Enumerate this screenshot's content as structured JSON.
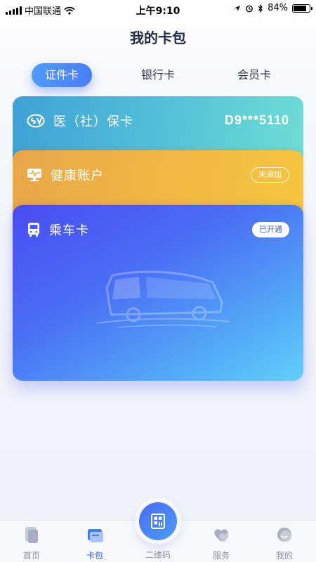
{
  "status_bar": {
    "carrier": "中国联通",
    "time": "上午9:10",
    "battery": "84%",
    "battery_level": 0.84
  },
  "header": {
    "title": "我的卡包"
  },
  "tabs": [
    {
      "label": "证件卡",
      "active": true
    },
    {
      "label": "银行卡",
      "active": false
    },
    {
      "label": "会员卡",
      "active": false
    }
  ],
  "cards": {
    "social_security": {
      "title": "医（社）保卡",
      "number": "D9***5110",
      "icon": "social-security-logo-icon"
    },
    "health": {
      "title": "健康账户",
      "badge": "未添加",
      "icon": "health-monitor-icon"
    },
    "bus": {
      "title": "乘车卡",
      "badge": "已开通",
      "icon": "bus-icon"
    }
  },
  "bottom_nav": {
    "items": [
      {
        "label": "首页",
        "icon": "home-icon",
        "active": false
      },
      {
        "label": "卡包",
        "icon": "wallet-icon",
        "active": true
      },
      {
        "label": "二维码",
        "icon": "qr-code-icon",
        "active": false
      },
      {
        "label": "服务",
        "icon": "heart-service-icon",
        "active": false
      },
      {
        "label": "我的",
        "icon": "profile-icon",
        "active": false
      }
    ]
  },
  "colors": {
    "accent": "#4a7df8",
    "social_card": "#52c0d8",
    "health_card": "#f0b744",
    "bus_card": "#4a6ff5"
  }
}
